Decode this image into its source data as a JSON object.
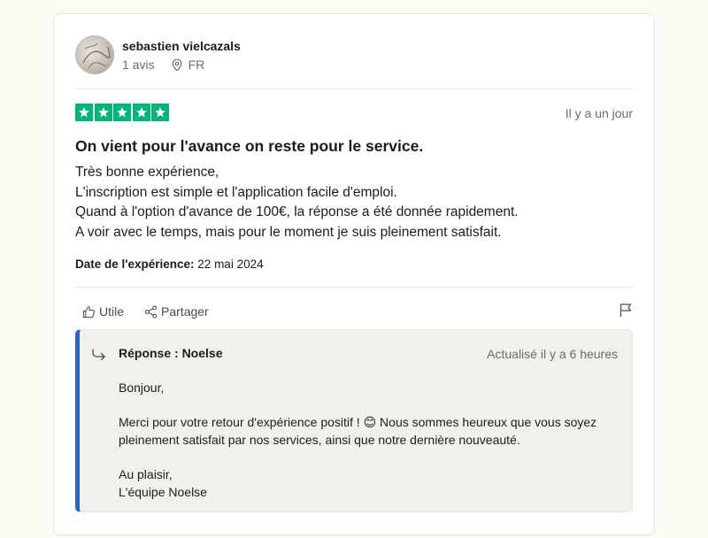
{
  "reviewer": {
    "name": "sebastien vielcazals",
    "review_count": "1 avis",
    "country": "FR"
  },
  "review": {
    "rating": 5,
    "date_ago": "Il y a un jour",
    "title": "On vient pour l'avance on reste pour le service.",
    "body_lines": [
      "Très bonne expérience,",
      "L'inscription est simple et l'application facile d'emploi.",
      "Quand à l'option d'avance de 100€, la réponse a été donnée rapidement.",
      "A voir avec le temps, mais pour le moment je suis pleinement satisfait."
    ],
    "experience_label": "Date de l'expérience:",
    "experience_date": "22 mai 2024"
  },
  "actions": {
    "useful_label": "Utile",
    "share_label": "Partager"
  },
  "reply": {
    "title": "Réponse : Noelse",
    "updated": "Actualisé il y a 6 heures",
    "greeting": "Bonjour,",
    "message": "Merci pour votre retour d'expérience positif ! 😊 Nous sommes heureux que vous soyez pleinement satisfait par nos services, ainsi que notre dernière nouveauté.",
    "closing_1": "Au plaisir,",
    "closing_2": "L'équipe Noelse"
  },
  "colors": {
    "star": "#00b67a",
    "reply_accent": "#2b5fd4",
    "reply_bg": "#f1f0eb",
    "page_bg": "#fcfbf3"
  },
  "icons": [
    "location-pin-icon",
    "star-icon",
    "thumbs-up-icon",
    "share-icon",
    "flag-icon",
    "reply-arrow-icon"
  ]
}
